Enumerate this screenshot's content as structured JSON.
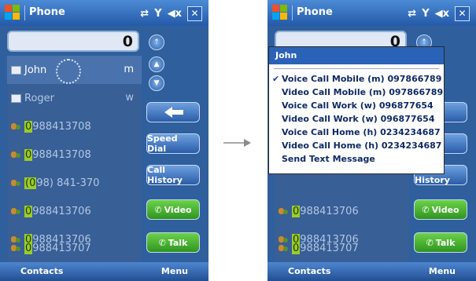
{
  "titlebar": {
    "title": "Phone",
    "close_glyph": "✕",
    "connect_glyph": "⇄",
    "signal_glyph": "Y",
    "volume_glyph": "◀x"
  },
  "dialer": {
    "number_value": "0"
  },
  "contacts": [
    {
      "type": "contact",
      "name": "John",
      "tag": "m",
      "selected": true
    },
    {
      "type": "contact",
      "name": "Roger",
      "tag": "w",
      "selected": false
    },
    {
      "type": "call",
      "highlight": "0",
      "rest": "988413708"
    },
    {
      "type": "call",
      "highlight": "0",
      "rest": "988413708"
    },
    {
      "type": "call",
      "highlight": "(0",
      "rest": "98) 841-370",
      "highlight_pre": "",
      "mid": ""
    },
    {
      "type": "call",
      "highlight": "0",
      "rest": "988413706"
    },
    {
      "type": "call",
      "highlight": "0",
      "rest": "988413706"
    },
    {
      "type": "call",
      "highlight": "0",
      "rest": "988413707"
    }
  ],
  "buttons": {
    "speed_dial": "Speed Dial",
    "call_history": "Call History",
    "video": "Video",
    "talk": "Talk",
    "back_glyph": "⬅"
  },
  "softkeys": {
    "left": "Contacts",
    "right": "Menu"
  },
  "context_menu": {
    "header": "John",
    "items": [
      {
        "label": "Voice Call Mobile (m) 097866789",
        "checked": true
      },
      {
        "label": "Video Call Mobile (m) 097866789",
        "checked": false
      },
      {
        "label": "Voice Call Work (w) 096877654",
        "checked": false
      },
      {
        "label": "Video Call Work (w) 096877654",
        "checked": false
      },
      {
        "label": "Voice Call Home (h) 0234234687",
        "checked": false
      },
      {
        "label": "Video Call Home (h) 0234234687",
        "checked": false
      },
      {
        "label": "Send Text Message",
        "checked": false
      }
    ]
  },
  "colors": {
    "menu_header": "#2a62b8",
    "highlight": "#9ccc26",
    "green_button": "#3fa22a"
  }
}
